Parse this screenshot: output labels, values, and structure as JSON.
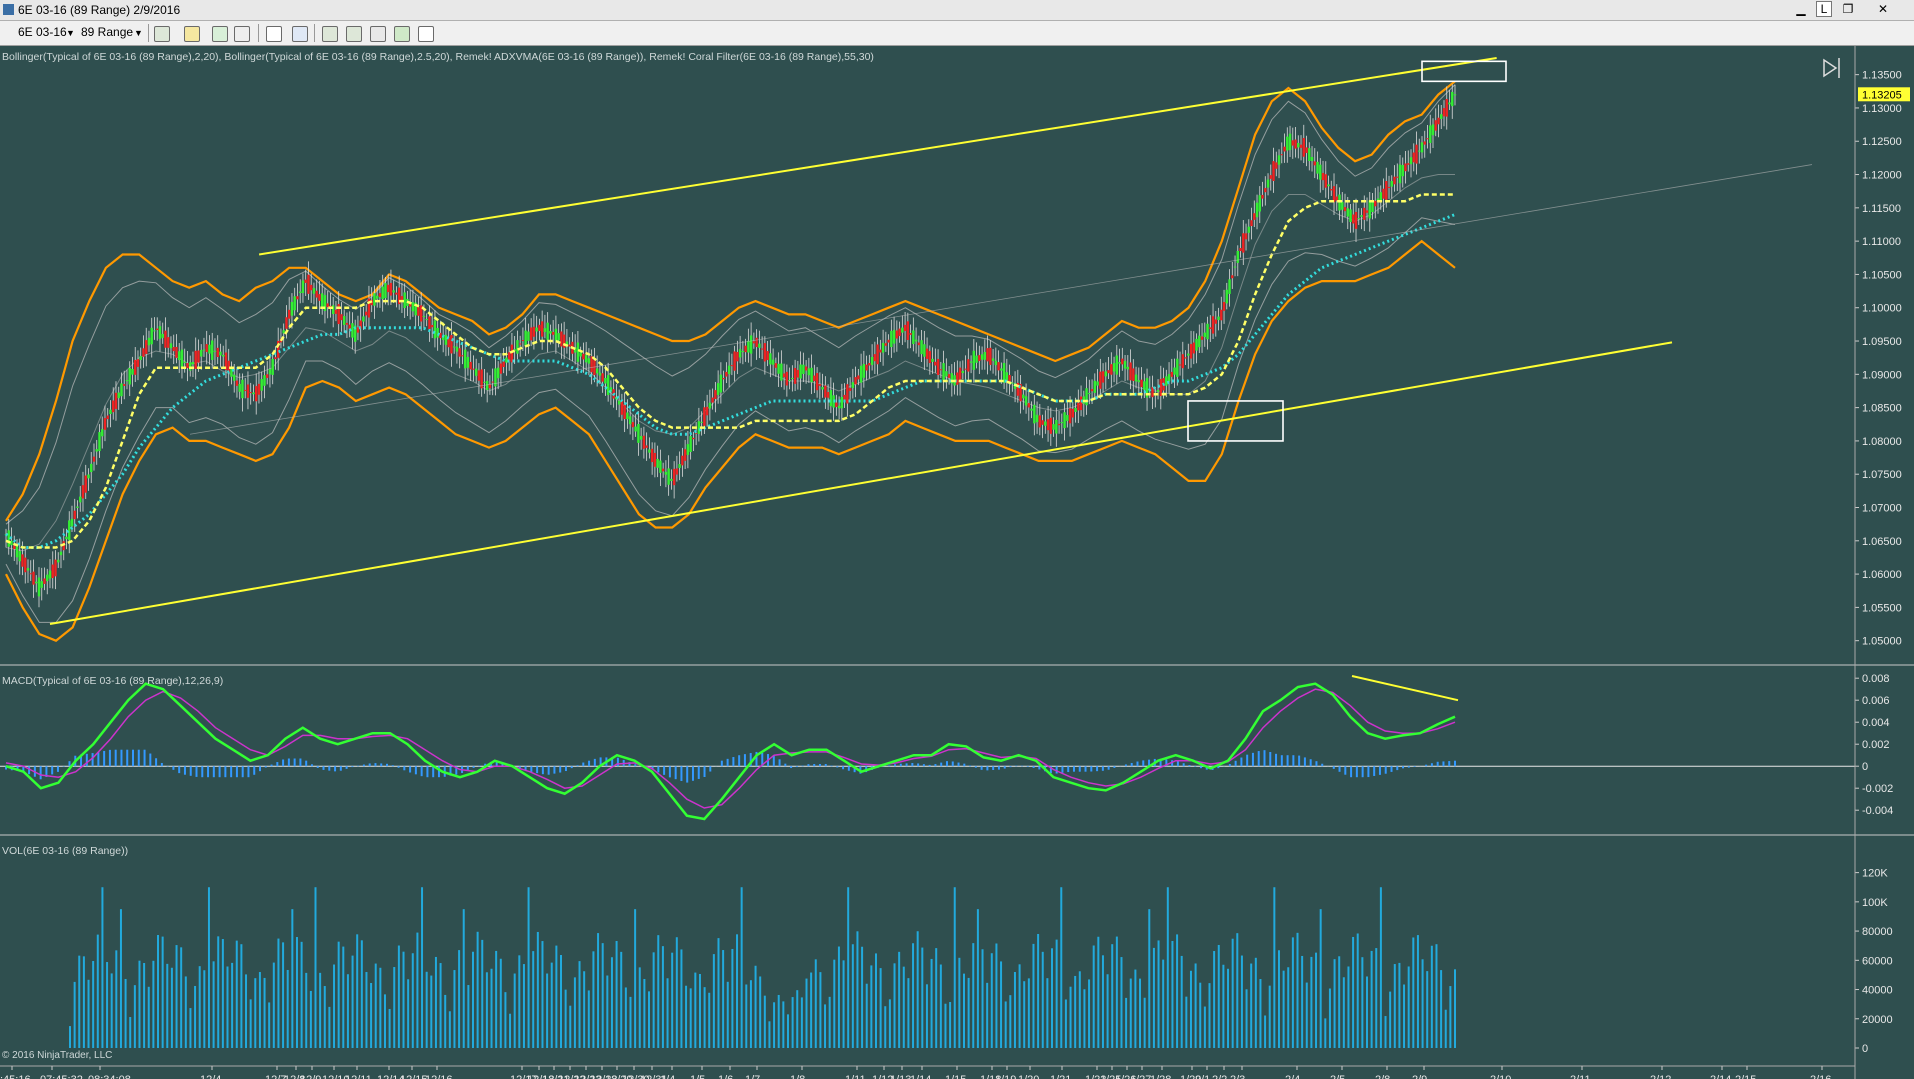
{
  "window": {
    "title": "6E 03-16 (89 Range)  2/9/2016",
    "min_label": "▁",
    "link_label": "L",
    "restore_label": "❐",
    "close_label": "✕"
  },
  "toolbar": {
    "instrument": "6E 03-16",
    "period": "89 Range"
  },
  "colors": {
    "background": "#2f4f4f",
    "trend_line": "#ffff33",
    "bollinger_outer": "#ff9900",
    "bollinger_inner": "#c0c0c0",
    "adxvma": "#ffff66",
    "coral": "#33dddd",
    "macd": "#33ff33",
    "macd_signal": "#cc33cc",
    "histogram": "#3399ff",
    "volume": "#22aadd"
  },
  "chart_data": [
    {
      "type": "candlestick",
      "title": "Bollinger(Typical of 6E 03-16 (89 Range),2,20), Bollinger(Typical of 6E 03-16 (89 Range),2.5,20), Remek! ADXVMA(6E 03-16 (89 Range)), Remek! Coral Filter(6E 03-16 (89 Range),55,30)",
      "y_ticks": [
        "1.13500",
        "1.13000",
        "1.12500",
        "1.12000",
        "1.11500",
        "1.11000",
        "1.10500",
        "1.10000",
        "1.09500",
        "1.09000",
        "1.08500",
        "1.08000",
        "1.07500",
        "1.07000",
        "1.06500",
        "1.06000",
        "1.05500",
        "1.05000"
      ],
      "ylim": [
        1.0465,
        1.1375
      ],
      "last_price": "1.13205",
      "close_series": [
        1.066,
        1.062,
        1.058,
        1.061,
        1.068,
        1.075,
        1.083,
        1.088,
        1.092,
        1.097,
        1.094,
        1.091,
        1.094,
        1.093,
        1.088,
        1.087,
        1.091,
        1.099,
        1.104,
        1.101,
        1.099,
        1.096,
        1.101,
        1.103,
        1.101,
        1.099,
        1.096,
        1.094,
        1.091,
        1.088,
        1.092,
        1.095,
        1.097,
        1.096,
        1.094,
        1.092,
        1.089,
        1.085,
        1.081,
        1.077,
        1.074,
        1.079,
        1.084,
        1.089,
        1.093,
        1.095,
        1.092,
        1.089,
        1.091,
        1.088,
        1.085,
        1.089,
        1.092,
        1.095,
        1.097,
        1.094,
        1.091,
        1.089,
        1.092,
        1.093,
        1.09,
        1.087,
        1.083,
        1.082,
        1.084,
        1.087,
        1.09,
        1.092,
        1.089,
        1.087,
        1.09,
        1.093,
        1.096,
        1.099,
        1.108,
        1.114,
        1.12,
        1.125,
        1.124,
        1.12,
        1.116,
        1.113,
        1.115,
        1.118,
        1.121,
        1.124,
        1.128,
        1.132
      ],
      "upper_band": [
        1.068,
        1.072,
        1.078,
        1.086,
        1.095,
        1.101,
        1.106,
        1.108,
        1.108,
        1.106,
        1.104,
        1.103,
        1.104,
        1.102,
        1.101,
        1.103,
        1.104,
        1.106,
        1.106,
        1.104,
        1.102,
        1.101,
        1.102,
        1.105,
        1.104,
        1.102,
        1.1,
        1.099,
        1.098,
        1.096,
        1.097,
        1.099,
        1.102,
        1.102,
        1.101,
        1.1,
        1.099,
        1.098,
        1.097,
        1.096,
        1.095,
        1.095,
        1.096,
        1.098,
        1.1,
        1.101,
        1.1,
        1.099,
        1.099,
        1.098,
        1.097,
        1.098,
        1.099,
        1.1,
        1.101,
        1.1,
        1.099,
        1.098,
        1.097,
        1.096,
        1.095,
        1.094,
        1.093,
        1.092,
        1.093,
        1.094,
        1.096,
        1.098,
        1.097,
        1.097,
        1.098,
        1.1,
        1.104,
        1.11,
        1.118,
        1.126,
        1.131,
        1.133,
        1.131,
        1.127,
        1.124,
        1.122,
        1.123,
        1.126,
        1.128,
        1.129,
        1.132,
        1.134
      ],
      "lower_band": [
        1.06,
        1.055,
        1.051,
        1.05,
        1.052,
        1.058,
        1.065,
        1.072,
        1.077,
        1.081,
        1.082,
        1.08,
        1.08,
        1.079,
        1.078,
        1.077,
        1.078,
        1.082,
        1.088,
        1.089,
        1.088,
        1.086,
        1.087,
        1.088,
        1.087,
        1.085,
        1.083,
        1.081,
        1.08,
        1.079,
        1.08,
        1.082,
        1.084,
        1.085,
        1.083,
        1.081,
        1.077,
        1.073,
        1.069,
        1.067,
        1.067,
        1.069,
        1.073,
        1.076,
        1.079,
        1.081,
        1.08,
        1.079,
        1.079,
        1.079,
        1.078,
        1.079,
        1.08,
        1.081,
        1.083,
        1.082,
        1.081,
        1.08,
        1.08,
        1.08,
        1.079,
        1.078,
        1.077,
        1.077,
        1.077,
        1.078,
        1.079,
        1.08,
        1.079,
        1.078,
        1.076,
        1.074,
        1.074,
        1.078,
        1.086,
        1.093,
        1.098,
        1.101,
        1.103,
        1.104,
        1.104,
        1.104,
        1.105,
        1.106,
        1.108,
        1.11,
        1.108,
        1.106
      ],
      "coral_filter": [
        1.066,
        1.064,
        1.064,
        1.065,
        1.067,
        1.069,
        1.072,
        1.075,
        1.079,
        1.082,
        1.085,
        1.087,
        1.089,
        1.09,
        1.091,
        1.092,
        1.093,
        1.094,
        1.095,
        1.096,
        1.096,
        1.097,
        1.097,
        1.097,
        1.097,
        1.097,
        1.096,
        1.095,
        1.094,
        1.093,
        1.092,
        1.092,
        1.092,
        1.092,
        1.091,
        1.09,
        1.088,
        1.086,
        1.084,
        1.082,
        1.081,
        1.081,
        1.082,
        1.083,
        1.084,
        1.085,
        1.086,
        1.086,
        1.086,
        1.086,
        1.086,
        1.086,
        1.086,
        1.087,
        1.088,
        1.089,
        1.089,
        1.089,
        1.089,
        1.089,
        1.089,
        1.088,
        1.087,
        1.086,
        1.086,
        1.086,
        1.087,
        1.087,
        1.087,
        1.088,
        1.089,
        1.089,
        1.09,
        1.091,
        1.093,
        1.096,
        1.099,
        1.102,
        1.104,
        1.106,
        1.107,
        1.108,
        1.109,
        1.11,
        1.111,
        1.112,
        1.113,
        1.114
      ],
      "adxvma": [
        1.065,
        1.064,
        1.064,
        1.064,
        1.065,
        1.068,
        1.073,
        1.08,
        1.087,
        1.091,
        1.091,
        1.091,
        1.091,
        1.091,
        1.091,
        1.091,
        1.093,
        1.097,
        1.1,
        1.1,
        1.1,
        1.1,
        1.101,
        1.101,
        1.101,
        1.1,
        1.098,
        1.096,
        1.094,
        1.093,
        1.093,
        1.094,
        1.095,
        1.095,
        1.094,
        1.093,
        1.091,
        1.088,
        1.085,
        1.083,
        1.082,
        1.082,
        1.082,
        1.082,
        1.082,
        1.083,
        1.083,
        1.083,
        1.083,
        1.083,
        1.083,
        1.084,
        1.086,
        1.088,
        1.089,
        1.089,
        1.089,
        1.089,
        1.089,
        1.089,
        1.089,
        1.088,
        1.087,
        1.086,
        1.086,
        1.086,
        1.087,
        1.087,
        1.087,
        1.087,
        1.087,
        1.087,
        1.088,
        1.09,
        1.095,
        1.102,
        1.108,
        1.113,
        1.115,
        1.116,
        1.116,
        1.116,
        1.116,
        1.116,
        1.116,
        1.117,
        1.117,
        1.117
      ]
    },
    {
      "type": "line",
      "title": "MACD(Typical of 6E 03-16 (89 Range),12,26,9)",
      "y_ticks": [
        "0.008",
        "0.006",
        "0.004",
        "0.002",
        "0",
        "-0.002",
        "-0.004"
      ],
      "ylim": [
        -0.0058,
        0.0082
      ],
      "series": [
        {
          "name": "MACD",
          "values": [
            0.0,
            -0.0005,
            -0.002,
            -0.0015,
            0.0005,
            0.002,
            0.004,
            0.006,
            0.0075,
            0.007,
            0.0055,
            0.004,
            0.0025,
            0.0015,
            0.0005,
            0.001,
            0.0025,
            0.0035,
            0.0025,
            0.002,
            0.0025,
            0.003,
            0.003,
            0.002,
            0.0005,
            -0.0005,
            -0.001,
            -0.0005,
            0.0005,
            0.0,
            -0.001,
            -0.002,
            -0.0025,
            -0.0015,
            0.0,
            0.001,
            0.0005,
            -0.0005,
            -0.0025,
            -0.0045,
            -0.0048,
            -0.003,
            -0.001,
            0.001,
            0.002,
            0.001,
            0.0015,
            0.0015,
            0.0005,
            -0.0005,
            0.0,
            0.0005,
            0.001,
            0.001,
            0.002,
            0.0018,
            0.0008,
            0.0005,
            0.001,
            0.0005,
            -0.001,
            -0.0015,
            -0.002,
            -0.0022,
            -0.0015,
            -0.0005,
            0.0005,
            0.001,
            0.0005,
            -0.0002,
            0.0005,
            0.0025,
            0.005,
            0.006,
            0.0072,
            0.0075,
            0.0065,
            0.0045,
            0.003,
            0.0025,
            0.0028,
            0.003,
            0.0038,
            0.0045
          ]
        },
        {
          "name": "Avg",
          "values": [
            0.0003,
            0.0,
            -0.0008,
            -0.001,
            -0.0005,
            0.0008,
            0.0025,
            0.0045,
            0.006,
            0.0068,
            0.0062,
            0.005,
            0.0035,
            0.0025,
            0.0015,
            0.001,
            0.0018,
            0.0028,
            0.0028,
            0.0025,
            0.0025,
            0.0027,
            0.0028,
            0.0025,
            0.0015,
            0.0005,
            -0.0003,
            -0.0005,
            0.0,
            0.0,
            -0.0005,
            -0.0012,
            -0.002,
            -0.0018,
            -0.0008,
            0.0002,
            0.0003,
            -0.0002,
            -0.0015,
            -0.003,
            -0.0038,
            -0.0035,
            -0.002,
            -0.0003,
            0.001,
            0.0012,
            0.0013,
            0.0013,
            0.0008,
            0.0002,
            0.0001,
            0.0003,
            0.0007,
            0.0009,
            0.0015,
            0.0016,
            0.0012,
            0.0008,
            0.0009,
            0.0007,
            -0.0003,
            -0.001,
            -0.0015,
            -0.0018,
            -0.0016,
            -0.001,
            -0.0002,
            0.0005,
            0.0005,
            0.0002,
            0.0004,
            0.0015,
            0.0035,
            0.005,
            0.0062,
            0.007,
            0.0067,
            0.0055,
            0.004,
            0.0032,
            0.003,
            0.003,
            0.0034,
            0.004
          ]
        }
      ]
    },
    {
      "type": "bar",
      "title": "VOL(6E 03-16 (89 Range))",
      "y_ticks": [
        "120K",
        "100K",
        "80000",
        "60000",
        "40000",
        "20000",
        "0"
      ],
      "ylim": [
        0,
        130000
      ],
      "x_ticks": [
        ":45:16",
        "07:45:32",
        "08:34:08",
        "12/4",
        "12/7",
        "12/8",
        "12/9",
        "12/10",
        "12/11",
        "12/14",
        "12/15",
        "12/16",
        "12/17",
        "12/18",
        "12/21",
        "12/22",
        "12/23",
        "12/28",
        "12/29",
        "12/30",
        "12/31",
        "1/4",
        "1/5",
        "1/6",
        "1/7",
        "1/8",
        "1/11",
        "1/12",
        "1/13",
        "1/14",
        "1/15",
        "1/18",
        "1/19",
        "1/20",
        "1/21",
        "1/22",
        "1/25",
        "1/26",
        "1/27",
        "1/28",
        "1/29",
        "2/1",
        "2/2",
        "2/3",
        "2/4",
        "2/5",
        "2/8",
        "2/9",
        "2/10",
        "2/11",
        "2/12",
        "2/14",
        "2/15",
        "2/16"
      ],
      "copyright": "© 2016 NinjaTrader, LLC"
    }
  ]
}
